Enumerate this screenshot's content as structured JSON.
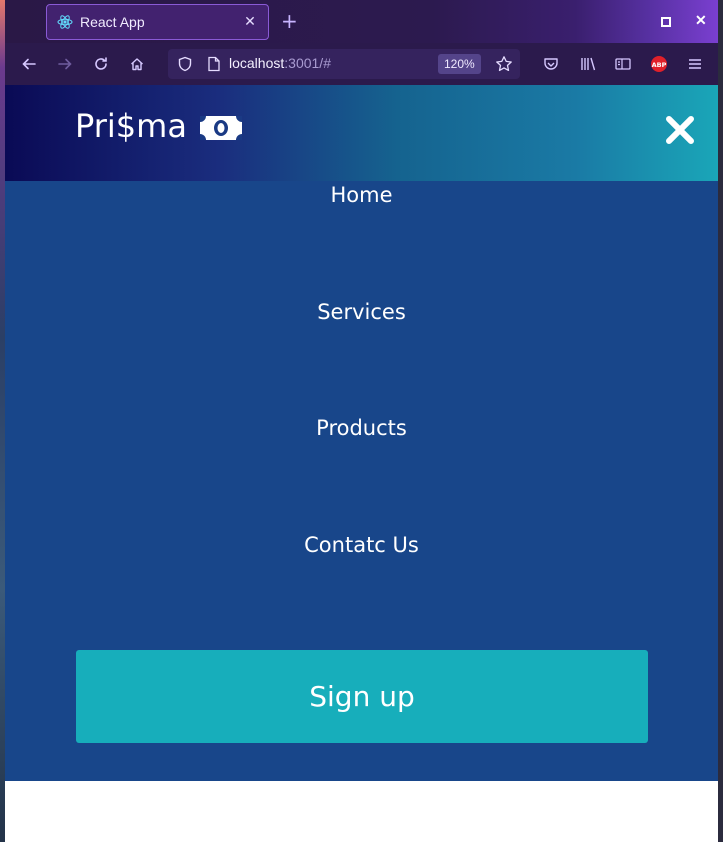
{
  "browser": {
    "tab": {
      "title": "React App",
      "close_glyph": "✕"
    },
    "new_tab_glyph": "+",
    "window": {
      "maximize_icon": "square-icon",
      "close_glyph": "✕"
    },
    "url": {
      "host": "localhost",
      "rest": ":3001/#"
    },
    "zoom": "120%",
    "toolbar_icons": [
      "back-icon",
      "forward-icon",
      "reload-icon",
      "home-icon",
      "shield-icon",
      "page-icon",
      "star-icon",
      "pocket-icon",
      "library-icon",
      "reader-icon",
      "abp-icon",
      "menu-icon"
    ]
  },
  "app": {
    "logo_text": "Pri$ma",
    "logo_icon": "money-bill-icon",
    "close_icon": "close-icon",
    "menu": [
      {
        "label": "Home"
      },
      {
        "label": "Services"
      },
      {
        "label": "Products"
      },
      {
        "label": "Contatc Us"
      }
    ],
    "signup_label": "Sign up",
    "colors": {
      "menu_bg": "#18468a",
      "button_bg": "#17aebb",
      "header_gradient_start": "#0a0a55",
      "header_gradient_end": "#1aa6b8"
    }
  }
}
